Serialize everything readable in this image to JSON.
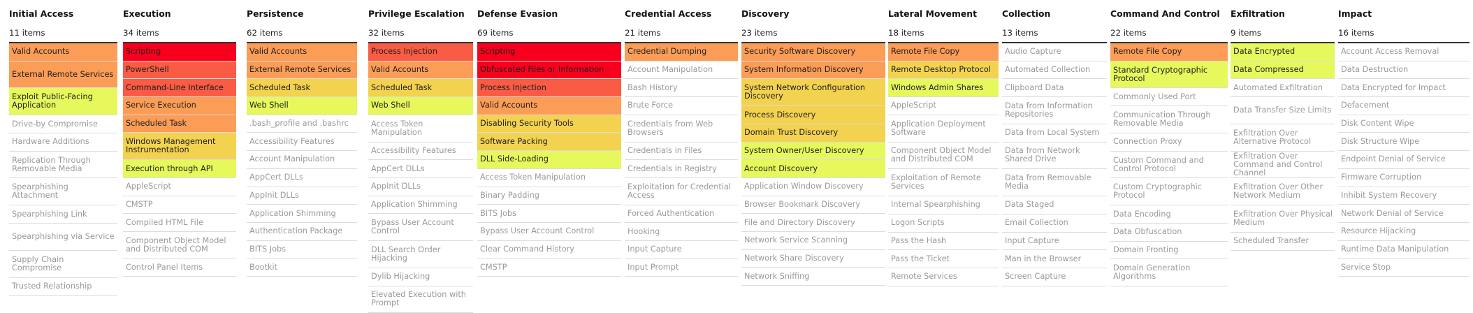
{
  "heat_colors": {
    "4": "#f8001d",
    "3": "#f95b44",
    "2": "#fc9d57",
    "1": "#f3d250",
    "0": "#e6f85c"
  },
  "columns": [
    {
      "name": "Initial Access",
      "count": "11 items",
      "cells": [
        {
          "label": "Valid Accounts",
          "score": 2
        },
        {
          "label": "External Remote Services",
          "score": 2
        },
        {
          "label": "Exploit Public-Facing Application",
          "score": 0
        },
        {
          "label": "Drive-by Compromise"
        },
        {
          "label": "Hardware Additions"
        },
        {
          "label": "Replication Through Removable Media"
        },
        {
          "label": "Spearphishing Attachment"
        },
        {
          "label": "Spearphishing Link"
        },
        {
          "label": "Spearphishing via Service"
        },
        {
          "label": "Supply Chain Compromise"
        },
        {
          "label": "Trusted Relationship"
        }
      ]
    },
    {
      "name": "Execution",
      "count": "34 items",
      "cells": [
        {
          "label": "Scripting",
          "score": 4
        },
        {
          "label": "PowerShell",
          "score": 3
        },
        {
          "label": "Command-Line Interface",
          "score": 3
        },
        {
          "label": "Service Execution",
          "score": 2
        },
        {
          "label": "Scheduled Task",
          "score": 2
        },
        {
          "label": "Windows Management Instrumentation",
          "score": 1
        },
        {
          "label": "Execution through API",
          "score": 0
        },
        {
          "label": "AppleScript"
        },
        {
          "label": "CMSTP"
        },
        {
          "label": "Compiled HTML File"
        },
        {
          "label": "Component Object Model and Distributed COM"
        },
        {
          "label": "Control Panel Items"
        }
      ]
    },
    {
      "name": "Persistence",
      "count": "62 items",
      "cells": [
        {
          "label": "Valid Accounts",
          "score": 2
        },
        {
          "label": "External Remote Services",
          "score": 2
        },
        {
          "label": "Scheduled Task",
          "score": 1
        },
        {
          "label": "Web Shell",
          "score": 0
        },
        {
          "label": ".bash_profile and .bashrc"
        },
        {
          "label": "Accessibility Features"
        },
        {
          "label": "Account Manipulation"
        },
        {
          "label": "AppCert DLLs"
        },
        {
          "label": "AppInit DLLs"
        },
        {
          "label": "Application Shimming"
        },
        {
          "label": "Authentication Package"
        },
        {
          "label": "BITS Jobs"
        },
        {
          "label": "Bootkit"
        }
      ]
    },
    {
      "name": "Privilege Escalation",
      "count": "32 items",
      "cells": [
        {
          "label": "Process Injection",
          "score": 3
        },
        {
          "label": "Valid Accounts",
          "score": 2
        },
        {
          "label": "Scheduled Task",
          "score": 1
        },
        {
          "label": "Web Shell",
          "score": 0
        },
        {
          "label": "Access Token Manipulation"
        },
        {
          "label": "Accessibility Features"
        },
        {
          "label": "AppCert DLLs"
        },
        {
          "label": "AppInit DLLs"
        },
        {
          "label": "Application Shimming"
        },
        {
          "label": "Bypass User Account Control"
        },
        {
          "label": "DLL Search Order Hijacking"
        },
        {
          "label": "Dylib Hijacking"
        },
        {
          "label": "Elevated Execution with Prompt"
        }
      ]
    },
    {
      "name": "Defense Evasion",
      "count": "69 items",
      "cells": [
        {
          "label": "Scripting",
          "score": 4
        },
        {
          "label": "Obfuscated Files or Information",
          "score": 4
        },
        {
          "label": "Process Injection",
          "score": 3
        },
        {
          "label": "Valid Accounts",
          "score": 2
        },
        {
          "label": "Disabling Security Tools",
          "score": 1
        },
        {
          "label": "Software Packing",
          "score": 1
        },
        {
          "label": "DLL Side-Loading",
          "score": 0
        },
        {
          "label": "Access Token Manipulation"
        },
        {
          "label": "Binary Padding"
        },
        {
          "label": "BITS Jobs"
        },
        {
          "label": "Bypass User Account Control"
        },
        {
          "label": "Clear Command History"
        },
        {
          "label": "CMSTP"
        }
      ]
    },
    {
      "name": "Credential Access",
      "count": "21 items",
      "cells": [
        {
          "label": "Credential Dumping",
          "score": 2
        },
        {
          "label": "Account Manipulation"
        },
        {
          "label": "Bash History"
        },
        {
          "label": "Brute Force"
        },
        {
          "label": "Credentials from Web Browsers"
        },
        {
          "label": "Credentials in Files"
        },
        {
          "label": "Credentials in Registry"
        },
        {
          "label": "Exploitation for Credential Access"
        },
        {
          "label": "Forced Authentication"
        },
        {
          "label": "Hooking"
        },
        {
          "label": "Input Capture"
        },
        {
          "label": "Input Prompt"
        }
      ]
    },
    {
      "name": "Discovery",
      "count": "23 items",
      "cells": [
        {
          "label": "Security Software Discovery",
          "score": 2
        },
        {
          "label": "System Information Discovery",
          "score": 2
        },
        {
          "label": "System Network Configuration Discovery",
          "score": 1
        },
        {
          "label": "Process Discovery",
          "score": 1
        },
        {
          "label": "Domain Trust Discovery",
          "score": 1
        },
        {
          "label": "System Owner/User Discovery",
          "score": 0
        },
        {
          "label": "Account Discovery",
          "score": 0
        },
        {
          "label": "Application Window Discovery"
        },
        {
          "label": "Browser Bookmark Discovery"
        },
        {
          "label": "File and Directory Discovery"
        },
        {
          "label": "Network Service Scanning"
        },
        {
          "label": "Network Share Discovery"
        },
        {
          "label": "Network Sniffing"
        }
      ]
    },
    {
      "name": "Lateral Movement",
      "count": "18 items",
      "cells": [
        {
          "label": "Remote File Copy",
          "score": 2
        },
        {
          "label": "Remote Desktop Protocol",
          "score": 1
        },
        {
          "label": "Windows Admin Shares",
          "score": 0
        },
        {
          "label": "AppleScript"
        },
        {
          "label": "Application Deployment Software"
        },
        {
          "label": "Component Object Model and Distributed COM"
        },
        {
          "label": "Exploitation of Remote Services"
        },
        {
          "label": "Internal Spearphishing"
        },
        {
          "label": "Logon Scripts"
        },
        {
          "label": "Pass the Hash"
        },
        {
          "label": "Pass the Ticket"
        },
        {
          "label": "Remote Services"
        }
      ]
    },
    {
      "name": "Collection",
      "count": "13 items",
      "cells": [
        {
          "label": "Audio Capture"
        },
        {
          "label": "Automated Collection"
        },
        {
          "label": "Clipboard Data"
        },
        {
          "label": "Data from Information Repositories"
        },
        {
          "label": "Data from Local System"
        },
        {
          "label": "Data from Network Shared Drive"
        },
        {
          "label": "Data from Removable Media"
        },
        {
          "label": "Data Staged"
        },
        {
          "label": "Email Collection"
        },
        {
          "label": "Input Capture"
        },
        {
          "label": "Man in the Browser"
        },
        {
          "label": "Screen Capture"
        }
      ]
    },
    {
      "name": "Command And Control",
      "count": "22 items",
      "cells": [
        {
          "label": "Remote File Copy",
          "score": 2
        },
        {
          "label": "Standard Cryptographic Protocol",
          "score": 0
        },
        {
          "label": "Commonly Used Port"
        },
        {
          "label": "Communication Through Removable Media"
        },
        {
          "label": "Connection Proxy"
        },
        {
          "label": "Custom Command and Control Protocol"
        },
        {
          "label": "Custom Cryptographic Protocol"
        },
        {
          "label": "Data Encoding"
        },
        {
          "label": "Data Obfuscation"
        },
        {
          "label": "Domain Fronting"
        },
        {
          "label": "Domain Generation Algorithms"
        }
      ]
    },
    {
      "name": "Exfiltration",
      "count": "9 items",
      "cells": [
        {
          "label": "Data Encrypted",
          "score": 0
        },
        {
          "label": "Data Compressed",
          "score": 0
        },
        {
          "label": "Automated Exfiltration"
        },
        {
          "label": "Data Transfer Size Limits"
        },
        {
          "label": "Exfiltration Over Alternative Protocol"
        },
        {
          "label": "Exfiltration Over Command and Control Channel"
        },
        {
          "label": "Exfiltration Over Other Network Medium"
        },
        {
          "label": "Exfiltration Over Physical Medium"
        },
        {
          "label": "Scheduled Transfer"
        }
      ]
    },
    {
      "name": "Impact",
      "count": "16 items",
      "cells": [
        {
          "label": "Account Access Removal"
        },
        {
          "label": "Data Destruction"
        },
        {
          "label": "Data Encrypted for Impact"
        },
        {
          "label": "Defacement"
        },
        {
          "label": "Disk Content Wipe"
        },
        {
          "label": "Disk Structure Wipe"
        },
        {
          "label": "Endpoint Denial of Service"
        },
        {
          "label": "Firmware Corruption"
        },
        {
          "label": "Inhibit System Recovery"
        },
        {
          "label": "Network Denial of Service"
        },
        {
          "label": "Resource Hijacking"
        },
        {
          "label": "Runtime Data Manipulation"
        },
        {
          "label": "Service Stop"
        }
      ]
    }
  ]
}
